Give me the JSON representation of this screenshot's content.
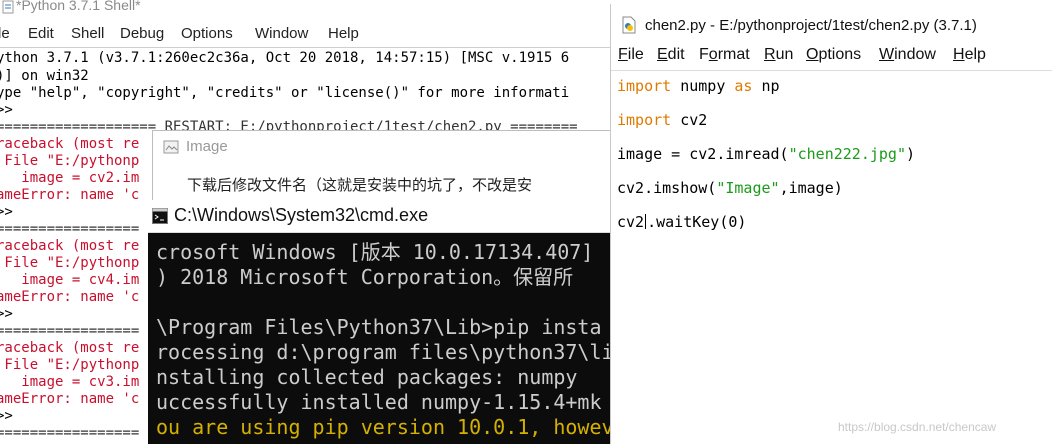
{
  "shell": {
    "title": "*Python 3.7.1 Shell*",
    "menu": [
      "le",
      "Edit",
      "Shell",
      "Debug",
      "Options",
      "Window",
      "Help"
    ],
    "lines": [
      {
        "text": "ython 3.7.1 (v3.7.1:260ec2c36a, Oct 20 2018, 14:57:15) [MSC v.1915 6",
        "cls": ""
      },
      {
        "text": ")] on win32",
        "cls": ""
      },
      {
        "text": "ype \"help\", \"copyright\", \"credits\" or \"license()\" for more informati",
        "cls": ""
      },
      {
        "text": ">>",
        "cls": ""
      },
      {
        "text": "=================== RESTART: E:/pythonproject/1test/chen2.py ========",
        "cls": "gap"
      },
      {
        "text": "raceback (most re",
        "cls": "red"
      },
      {
        "text": " File \"E:/pythonp",
        "cls": "red"
      },
      {
        "text": "   image = cv2.im",
        "cls": "red"
      },
      {
        "text": "ameError: name 'c",
        "cls": "red"
      },
      {
        "text": ">>",
        "cls": ""
      },
      {
        "text": "=================",
        "cls": "gap"
      },
      {
        "text": "raceback (most re",
        "cls": "red"
      },
      {
        "text": " File \"E:/pythonp",
        "cls": "red"
      },
      {
        "text": "   image = cv4.im",
        "cls": "red"
      },
      {
        "text": "ameError: name 'c",
        "cls": "red"
      },
      {
        "text": ">>",
        "cls": ""
      },
      {
        "text": "=================",
        "cls": "gap"
      },
      {
        "text": "raceback (most re",
        "cls": "red"
      },
      {
        "text": " File \"E:/pythonp",
        "cls": "red"
      },
      {
        "text": "   image = cv3.im",
        "cls": "red"
      },
      {
        "text": "ameError: name 'c",
        "cls": "red"
      },
      {
        "text": ">>",
        "cls": ""
      },
      {
        "text": "=================",
        "cls": "gap"
      }
    ]
  },
  "image_window": {
    "title": "Image",
    "content": "下载后修改文件名（这就是安装中的坑了，不改是安"
  },
  "cmd": {
    "title": "C:\\Windows\\System32\\cmd.exe",
    "lines": [
      {
        "text": "crosoft Windows [版本 10.0.17134.407]",
        "cls": ""
      },
      {
        "text": ") 2018 Microsoft Corporation。保留所",
        "cls": ""
      },
      {
        "text": "",
        "cls": ""
      },
      {
        "text": "\\Program Files\\Python37\\Lib>pip insta",
        "cls": ""
      },
      {
        "text": "rocessing d:\\program files\\python37\\li",
        "cls": ""
      },
      {
        "text": "nstalling collected packages: numpy",
        "cls": ""
      },
      {
        "text": "uccessfully installed numpy-1.15.4+mk",
        "cls": ""
      },
      {
        "text": "ou are using pip version 10.0.1, howev",
        "cls": "yellow"
      }
    ]
  },
  "editor": {
    "title": "chen2.py - E:/pythonproject/1test/chen2.py (3.7.1)",
    "menu": [
      {
        "u": "F",
        "rest": "ile"
      },
      {
        "u": "E",
        "rest": "dit"
      },
      {
        "pre": "F",
        "u": "o",
        "rest": "rmat"
      },
      {
        "u": "R",
        "rest": "un"
      },
      {
        "u": "O",
        "rest": "ptions"
      },
      {
        "u": "W",
        "rest": "indow"
      },
      {
        "u": "H",
        "rest": "elp"
      }
    ],
    "code": {
      "l1": {
        "kw1": "import",
        "mid": " numpy ",
        "kw2": "as",
        "end": " np"
      },
      "l2": {
        "kw": "import",
        "end": " cv2"
      },
      "l3": {
        "pre": "image = cv2.imread(",
        "str": "\"chen222.jpg\"",
        "end": ")"
      },
      "l4": {
        "pre": "cv2.imshow(",
        "str": "\"Image\"",
        "end": ",image)"
      },
      "l5": {
        "pre": "cv2",
        "end": ".waitKey(0)"
      }
    }
  },
  "watermark": "https://blog.csdn.net/chencaw"
}
